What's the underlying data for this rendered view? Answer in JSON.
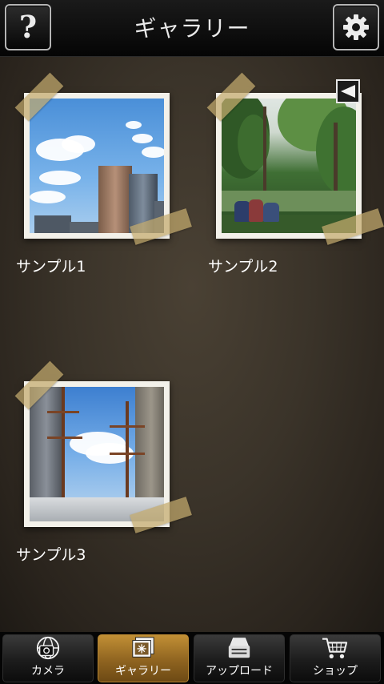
{
  "header": {
    "title": "ギャラリー",
    "help_icon": "question-mark-icon",
    "help_glyph": "?",
    "settings_icon": "gear-icon"
  },
  "gallery": {
    "items": [
      {
        "caption": "サンプル1",
        "thumbnail": "city-skyline-photo"
      },
      {
        "caption": "サンプル2",
        "thumbnail": "park-photo",
        "badge_icon": "flag-icon"
      },
      {
        "caption": "サンプル3",
        "thumbnail": "ship-masts-photo"
      }
    ]
  },
  "nav": {
    "items": [
      {
        "label": "カメラ",
        "icon": "camera-globe-icon",
        "active": false
      },
      {
        "label": "ギャラリー",
        "icon": "gallery-icon",
        "active": true
      },
      {
        "label": "アップロード",
        "icon": "upload-tray-icon",
        "active": false
      },
      {
        "label": "ショップ",
        "icon": "shopping-cart-icon",
        "active": false
      }
    ]
  },
  "colors": {
    "background": "#3a3329",
    "header": "#0a0a0a",
    "nav_active": "#a87a2c",
    "tape": "#c4aa6e",
    "text": "#ffffff"
  }
}
